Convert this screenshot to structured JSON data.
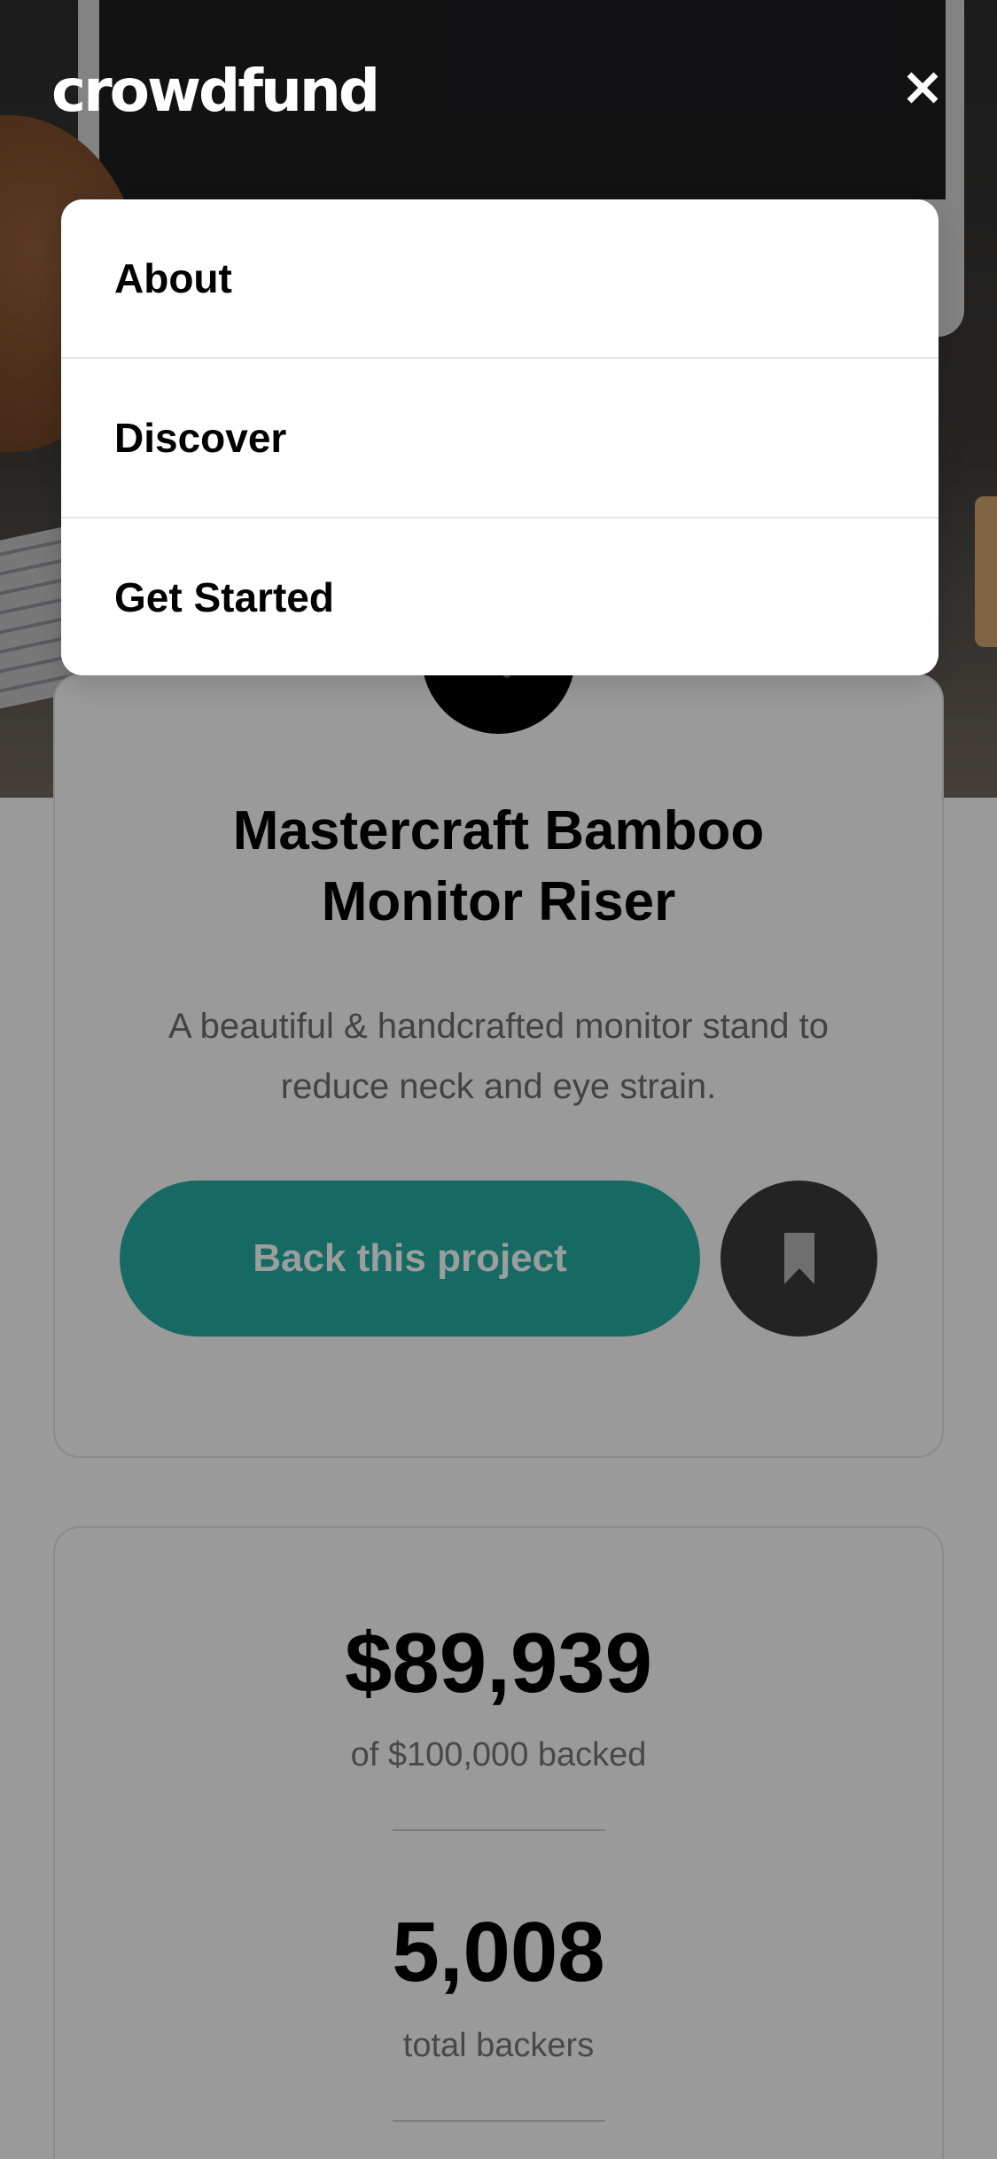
{
  "app": {
    "logo_text": "crowdfund"
  },
  "menu": {
    "items": [
      {
        "label": "About"
      },
      {
        "label": "Discover"
      },
      {
        "label": "Get Started"
      }
    ]
  },
  "project": {
    "title_line1": "Mastercraft Bamboo",
    "title_line2": "Monitor Riser",
    "description": "A beautiful & handcrafted monitor stand to reduce neck and eye strain.",
    "back_button_label": "Back this project"
  },
  "stats": {
    "amount_value": "$89,939",
    "amount_label": "of $100,000 backed",
    "backers_value": "5,008",
    "backers_label": "total backers"
  },
  "icons": {
    "close": "close-icon",
    "bookmark": "bookmark-icon",
    "project_logo": "mastercraft-logo-icon"
  },
  "colors": {
    "primary": "#176a63",
    "overlay_bg": "#9a9a9a",
    "menu_bg": "#ffffff",
    "bookmark_bg": "#232323"
  }
}
